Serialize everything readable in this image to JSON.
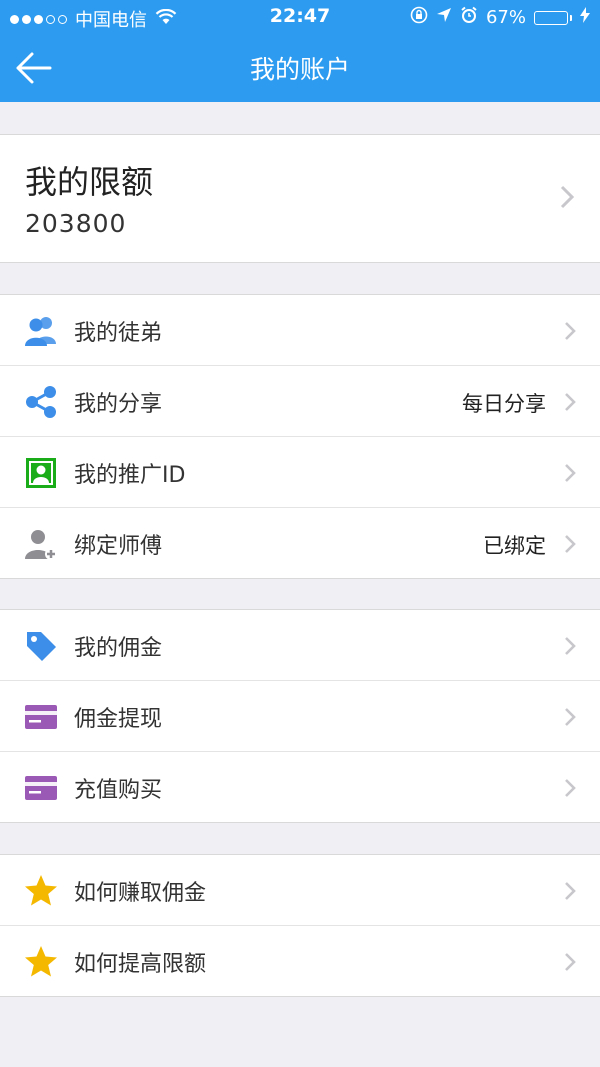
{
  "status_bar": {
    "carrier": "中国电信",
    "time": "22:47",
    "battery_percent": "67%",
    "battery_level": 0.67,
    "signal_dots": [
      true,
      true,
      true,
      false,
      false
    ]
  },
  "nav": {
    "title": "我的账户",
    "back_icon": "arrow-left-icon"
  },
  "limit": {
    "title": "我的限额",
    "value": "203800"
  },
  "groups": [
    {
      "items": [
        {
          "name": "my-apprentices",
          "label": "我的徒弟",
          "value": "",
          "icon": "users-icon",
          "color": "#3d8ee8"
        },
        {
          "name": "my-share",
          "label": "我的分享",
          "value": "每日分享",
          "icon": "share-icon",
          "color": "#3d8ee8"
        },
        {
          "name": "my-promo-id",
          "label": "我的推广ID",
          "value": "",
          "icon": "id-badge-icon",
          "color": "#1aad19"
        },
        {
          "name": "bind-master",
          "label": "绑定师傅",
          "value": "已绑定",
          "icon": "user-add-icon",
          "color": "#8e8e93"
        }
      ]
    },
    {
      "items": [
        {
          "name": "my-commission",
          "label": "我的佣金",
          "value": "",
          "icon": "tag-icon",
          "color": "#3d8ee8"
        },
        {
          "name": "commission-withdraw",
          "label": "佣金提现",
          "value": "",
          "icon": "card-icon",
          "color": "#9b59b6"
        },
        {
          "name": "recharge-purchase",
          "label": "充值购买",
          "value": "",
          "icon": "card-icon",
          "color": "#9b59b6"
        }
      ]
    },
    {
      "items": [
        {
          "name": "how-earn-commission",
          "label": "如何赚取佣金",
          "value": "",
          "icon": "star-icon",
          "color": "#f5b800"
        },
        {
          "name": "how-raise-limit",
          "label": "如何提高限额",
          "value": "",
          "icon": "star-icon",
          "color": "#f5b800"
        }
      ]
    }
  ]
}
